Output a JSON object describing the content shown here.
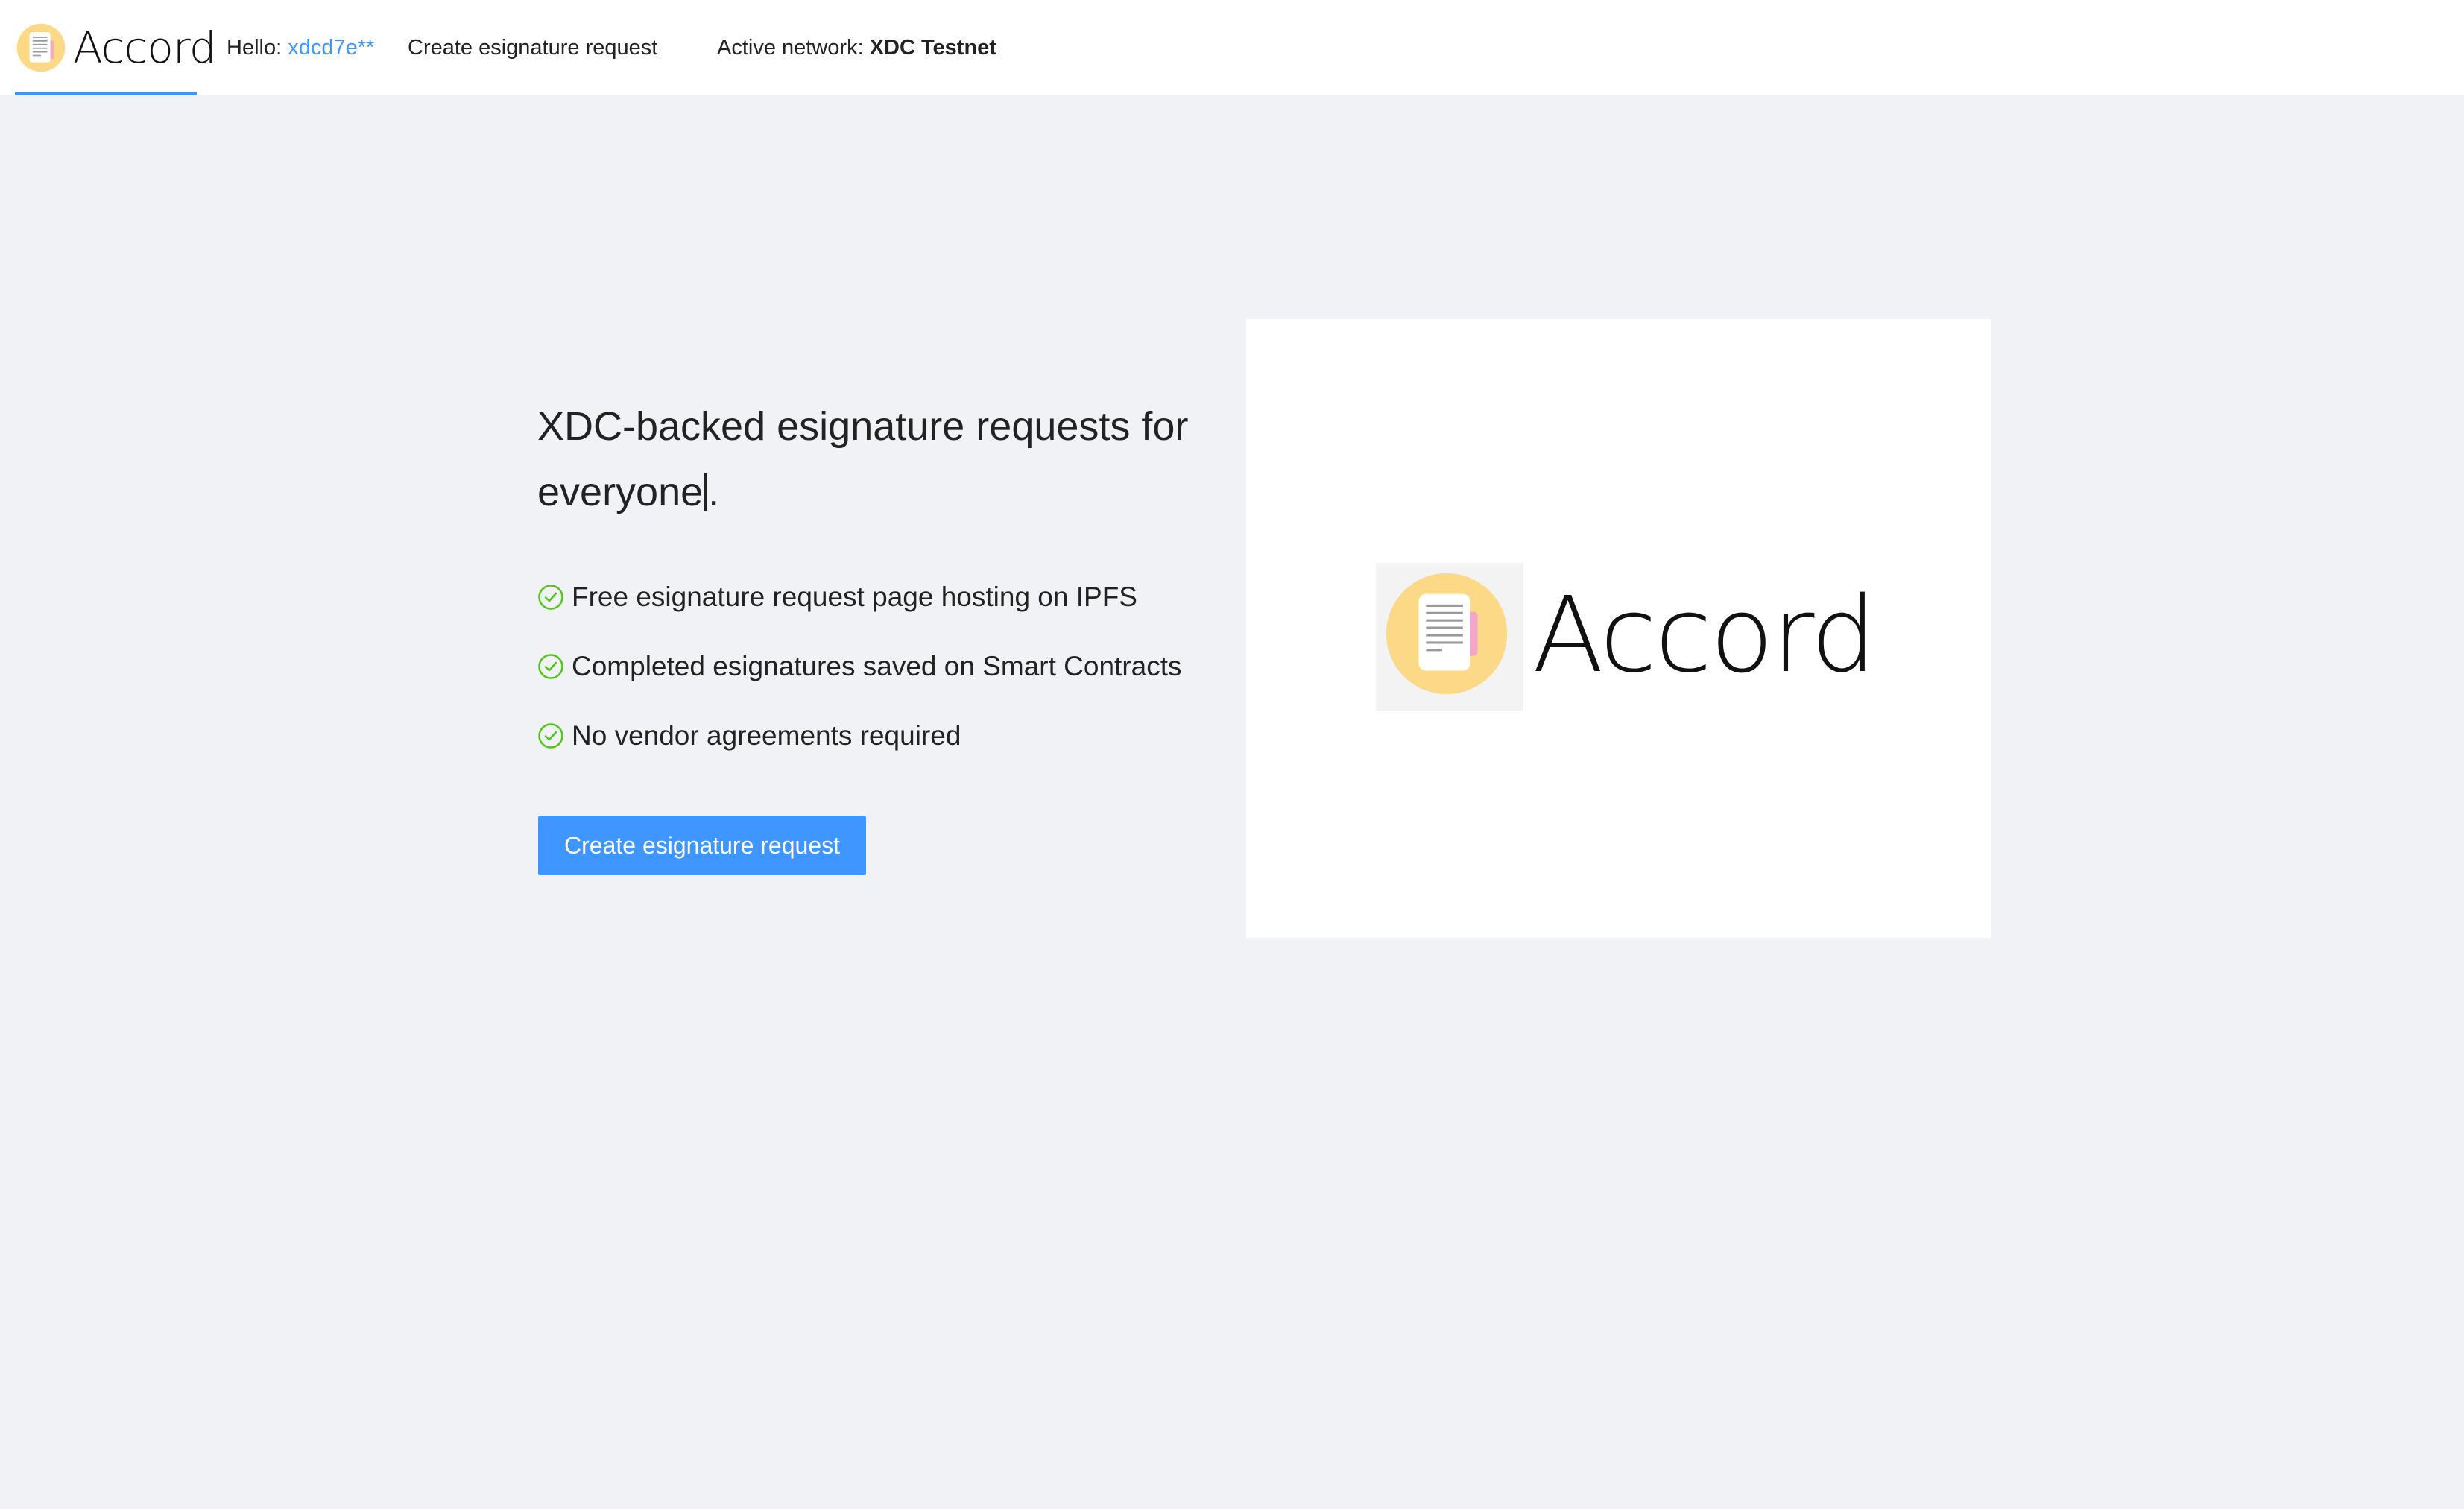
{
  "header": {
    "brand_name": "Accord",
    "hello_label": "Hello:",
    "user_short": "xdcd7e**",
    "create_link": "Create esignature request",
    "network_label": "Active network:",
    "network_name": "XDC Testnet"
  },
  "hero": {
    "title_part1": "XDC-backed esignature requests for everyone",
    "title_part2": ".",
    "features": [
      "Free esignature request page hosting on IPFS",
      "Completed esignatures saved on Smart Contracts",
      "No vendor agreements required"
    ],
    "cta_label": "Create esignature request"
  },
  "card": {
    "brand_name": "Accord"
  },
  "icons": {
    "logo": "document-icon",
    "feature": "check-circle-icon"
  },
  "colors": {
    "accent": "#4096ff",
    "check": "#52c41a",
    "logo_circle": "#fbd986",
    "background": "#f0f2f5"
  }
}
